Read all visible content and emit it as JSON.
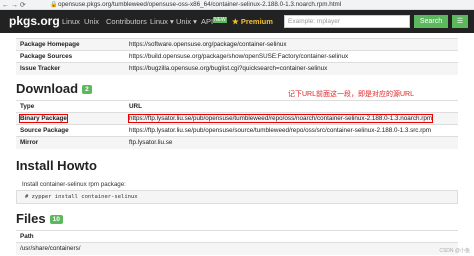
{
  "browser": {
    "url": "opensuse.pkgs.org/tumbleweed/opensuse-oss-x86_64/container-selinux-2.188.0-1.3.noarch.rpm.html"
  },
  "navbar": {
    "brand": "pkgs.org",
    "items": [
      "Linux",
      "Unix",
      "Contributors",
      "Linux",
      "Unix",
      "API",
      "Premium"
    ],
    "linux": "Linux",
    "unix": "Unix",
    "os": "Linux",
    "contributors": "Contributors",
    "api": "API",
    "api_badge": "NEW",
    "premium": "Premium",
    "search_placeholder": "Example: mplayer",
    "search_button": "Search"
  },
  "links_table": [
    {
      "key": "Package Homepage",
      "value": "https://software.opensuse.org/package/container-selinux"
    },
    {
      "key": "Package Sources",
      "value": "https://build.opensuse.org/package/show/openSUSE:Factory/container-selinux"
    },
    {
      "key": "Issue Tracker",
      "value": "https://bugzilla.opensuse.org/buglist.cgi?quicksearch=container-selinux"
    }
  ],
  "download": {
    "title": "Download",
    "count": "2",
    "header_type": "Type",
    "header_url": "URL",
    "rows": [
      {
        "key": "Binary Package",
        "value": "https://ftp.lysator.liu.se/pub/opensuse/tumbleweed/repo/oss/noarch/container-selinux-2.188.0-1.3.noarch.rpm"
      },
      {
        "key": "Source Package",
        "value": "https://ftp.lysator.liu.se/pub/opensuse/source/tumbleweed/repo/oss/src/container-selinux-2.188.0-1.3.src.rpm"
      },
      {
        "key": "Mirror",
        "value": "ftp.lysator.liu.se"
      }
    ],
    "annotation": "记下URL前面这一段，即是对应的源URL"
  },
  "howto": {
    "title": "Install Howto",
    "desc": "Install container-selinux rpm package:",
    "command": "# zypper install container-selinux"
  },
  "files": {
    "title": "Files",
    "count": "10",
    "header": "Path",
    "rows": [
      "/usr/share/containers/"
    ]
  },
  "watermark": "CSDN @小鱼"
}
